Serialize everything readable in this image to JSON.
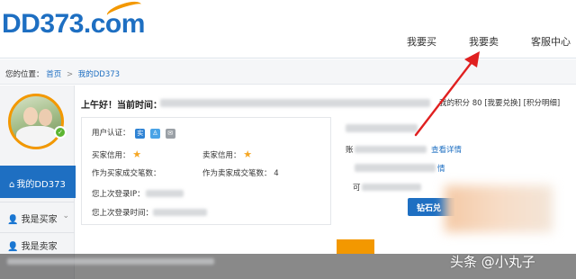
{
  "header": {
    "logo_text": "DD373.com",
    "nav": [
      "我要买",
      "我要卖",
      "客服中心"
    ]
  },
  "breadcrumb": {
    "label": "您的位置：",
    "home": "首页",
    "separator": ">",
    "current": "我的DD373"
  },
  "sidebar": {
    "active_item": "我的DD373",
    "buyer_item": "我是买家",
    "seller_item": "我是卖家"
  },
  "main": {
    "greeting": "上午好！当前时间：",
    "points_text": "我的积分 80",
    "points_exchange": "[我要兑换]",
    "points_detail": "[积分明细]",
    "auth_label": "用户认证：",
    "buyer_credit_label": "买家信用：",
    "seller_credit_label": "卖家信用：",
    "buyer_deals_label": "作为买家成交笔数：",
    "seller_deals_label": "作为卖家成交笔数：",
    "seller_deals_value": "4",
    "last_ip_label": "您上次登录IP：",
    "last_time_label": "您上次登录时间：",
    "right_label_1": "账",
    "right_link_1": "查看详情",
    "right_link_2": "情",
    "right_label_3": "可",
    "diamond_button": "钻石兑"
  },
  "footer": {
    "watermark": "头条 @小丸子"
  },
  "colors": {
    "brand_blue": "#1e6fc2",
    "accent_orange": "#f39800",
    "arrow_red": "#e02020",
    "star_gold": "#f5a623"
  },
  "icons": [
    "home-icon",
    "user-icon",
    "chevron-down-icon",
    "star-icon",
    "check-icon"
  ]
}
